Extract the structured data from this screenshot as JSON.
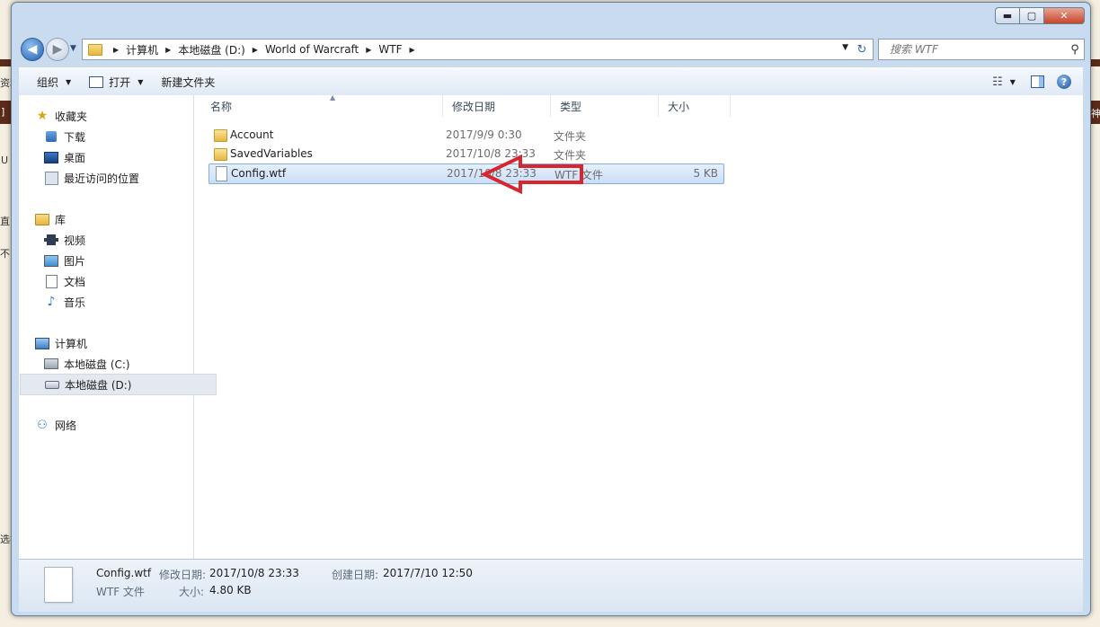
{
  "background_fragments": [
    "资料",
    "]",
    "U",
    "直",
    "不",
    "选择",
    "神"
  ],
  "window": {
    "controls": {
      "minimize": "▬",
      "maximize": "▢",
      "close": "✕"
    }
  },
  "nav": {
    "back_icon": "◀",
    "forward_icon": "▶",
    "recent_icon": "▼",
    "breadcrumbs": [
      "计算机",
      "本地磁盘 (D:)",
      "World of Warcraft",
      "WTF"
    ],
    "crumb_separator": "▶",
    "address_dropdown": "▼",
    "refresh_icon": "↻",
    "search_placeholder": "搜索 WTF",
    "search_icon": "⚲"
  },
  "toolbar": {
    "organize": "组织",
    "open": "打开",
    "new_folder": "新建文件夹",
    "caret": "▼",
    "view_icon": "☷",
    "view_caret": "▼",
    "help_icon": "?"
  },
  "sidebar": {
    "favorites": "收藏夹",
    "downloads": "下载",
    "desktop": "桌面",
    "recent": "最近访问的位置",
    "libraries": "库",
    "videos": "视频",
    "pictures": "图片",
    "documents": "文档",
    "music": "音乐",
    "computer": "计算机",
    "drive_c": "本地磁盘 (C:)",
    "drive_d": "本地磁盘 (D:)",
    "network": "网络"
  },
  "icons": {
    "star": "★",
    "music": "♪",
    "network": "⚇"
  },
  "columns": {
    "name": "名称",
    "date": "修改日期",
    "type": "类型",
    "size": "大小",
    "sort_indicator": "▲"
  },
  "files": [
    {
      "name": "Account",
      "date": "2017/9/9 0:30",
      "type": "文件夹",
      "size": ""
    },
    {
      "name": "SavedVariables",
      "date": "2017/10/8 23:33",
      "type": "文件夹",
      "size": ""
    },
    {
      "name": "Config.wtf",
      "date": "2017/10/8 23:33",
      "type": "WTF 文件",
      "size": "5 KB"
    }
  ],
  "annotation_color": "#d9262c",
  "details": {
    "name": "Config.wtf",
    "type": "WTF 文件",
    "modified_label": "修改日期:",
    "modified": "2017/10/8 23:33",
    "created_label": "创建日期:",
    "created": "2017/7/10 12:50",
    "size_label": "大小:",
    "size": "4.80 KB"
  }
}
